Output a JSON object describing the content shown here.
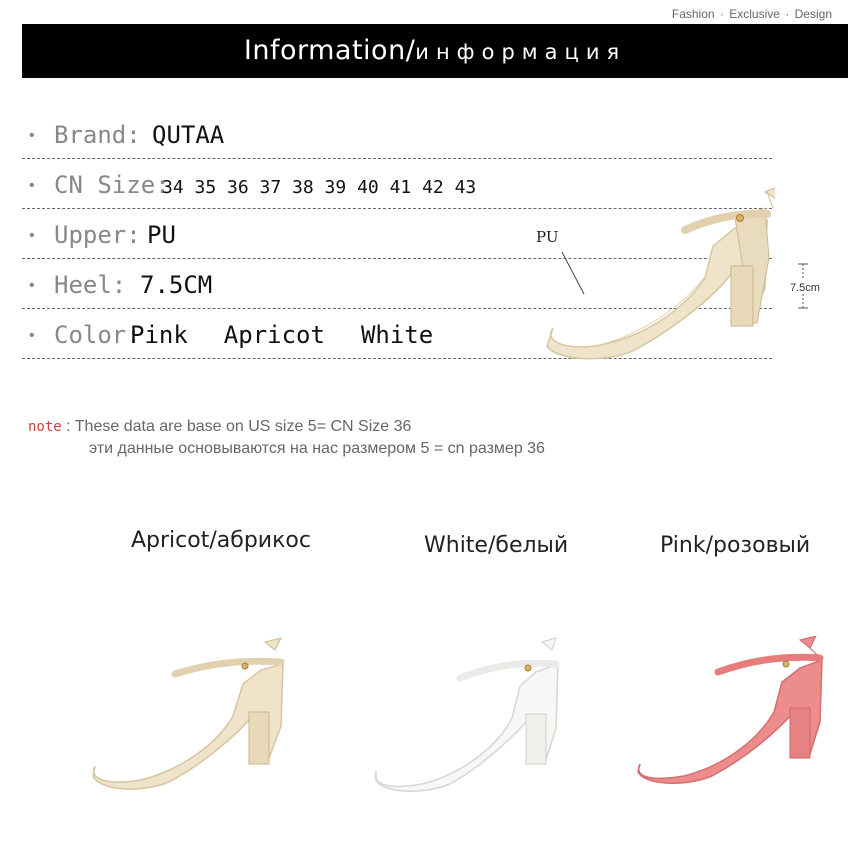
{
  "header": {
    "tagline": [
      "Fashion",
      "Exclusive",
      "Design"
    ],
    "title_en": "Information",
    "title_ru": "информация"
  },
  "info": {
    "brand_label": "Brand:",
    "brand_value": "QUTAA",
    "size_label": "CN Size:",
    "size_value": "34 35 36 37 38 39 40 41 42 43",
    "upper_label": "Upper:",
    "upper_value": "PU",
    "heel_label": "Heel:",
    "heel_value": "7.5CM",
    "color_label": "Color:",
    "colors": [
      "Pink",
      "Apricot",
      "White"
    ]
  },
  "diagram": {
    "material_label": "PU",
    "heel_height_label": "7.5cm"
  },
  "note": {
    "tag": "note",
    "separator": ":",
    "line_en": "These data are base on US size 5= CN Size 36",
    "line_ru": "эти данные основываются на нас размером 5 = cn размер 36"
  },
  "variants": [
    {
      "caption": "Apricot/абрикос",
      "color": "#efe3c9"
    },
    {
      "caption": "White/белый",
      "color": "#f7f7f5"
    },
    {
      "caption": "Pink/розовый",
      "color": "#ec8c8c"
    }
  ]
}
